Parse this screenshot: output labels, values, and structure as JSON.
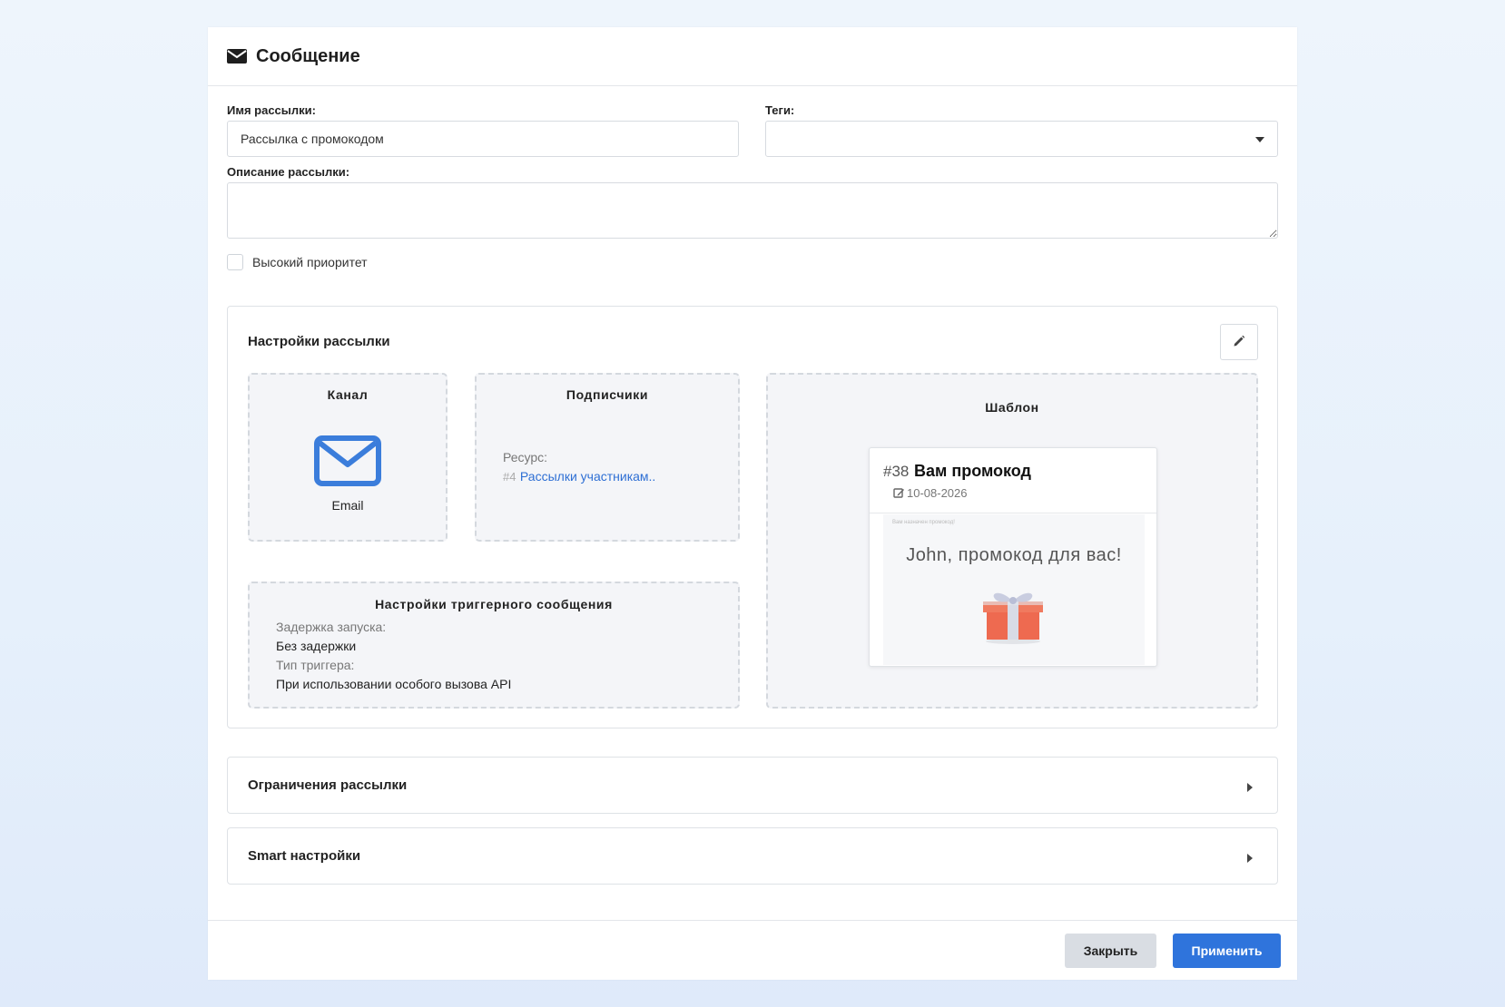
{
  "modal": {
    "title": "Сообщение",
    "icon": "envelope-icon"
  },
  "form": {
    "name_label": "Имя рассылки:",
    "name_value": "Рассылка с промокодом",
    "tags_label": "Теги:",
    "tags_value": "",
    "description_label": "Описание рассылки:",
    "description_value": "",
    "priority_label": "Высокий приоритет",
    "priority_checked": false
  },
  "settings": {
    "title": "Настройки рассылки",
    "channel": {
      "title": "Канал",
      "name": "Email",
      "icon": "envelope-icon",
      "color": "#3b7ddb"
    },
    "subscribers": {
      "title": "Подписчики",
      "resource_label": "Ресурс:",
      "resource_id": "#4",
      "resource_name": "Рассылки участникам.."
    },
    "trigger": {
      "title": "Настройки триггерного сообщения",
      "delay_label": "Задержка запуска:",
      "delay_value": "Без задержки",
      "type_label": "Тип триггера:",
      "type_value": "При использовании особого вызова API"
    },
    "template": {
      "title": "Шаблон",
      "number": "#38",
      "name": "Вам промокод",
      "date": "10-08-2026",
      "preview_small": "Вам назначен промокод!",
      "preview_text": "John, промокод для вас!"
    }
  },
  "sections": [
    {
      "title": "Ограничения рассылки"
    },
    {
      "title": "Smart настройки"
    }
  ],
  "footer": {
    "close_label": "Закрыть",
    "apply_label": "Применить",
    "accent_color": "#2f74dc"
  }
}
